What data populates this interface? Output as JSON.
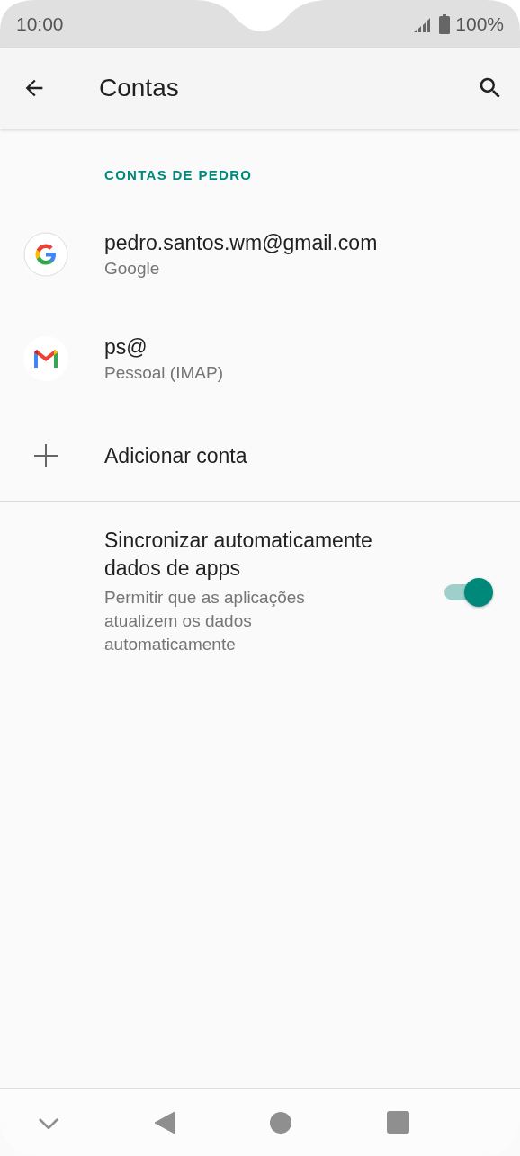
{
  "status_bar": {
    "time": "10:00",
    "battery": "100%"
  },
  "app_bar": {
    "title": "Contas"
  },
  "section": {
    "title": "CONTAS DE PEDRO"
  },
  "accounts": [
    {
      "name": "pedro.santos.wm@gmail.com",
      "type": "Google",
      "kind": "google"
    },
    {
      "name": "ps@",
      "type": "Pessoal (IMAP)",
      "kind": "gmail"
    }
  ],
  "add_account": {
    "label": "Adicionar conta"
  },
  "sync": {
    "title": "Sincronizar automaticamente dados de apps",
    "summary": "Permitir que as aplicações atualizem os dados automaticamente",
    "on": true
  }
}
